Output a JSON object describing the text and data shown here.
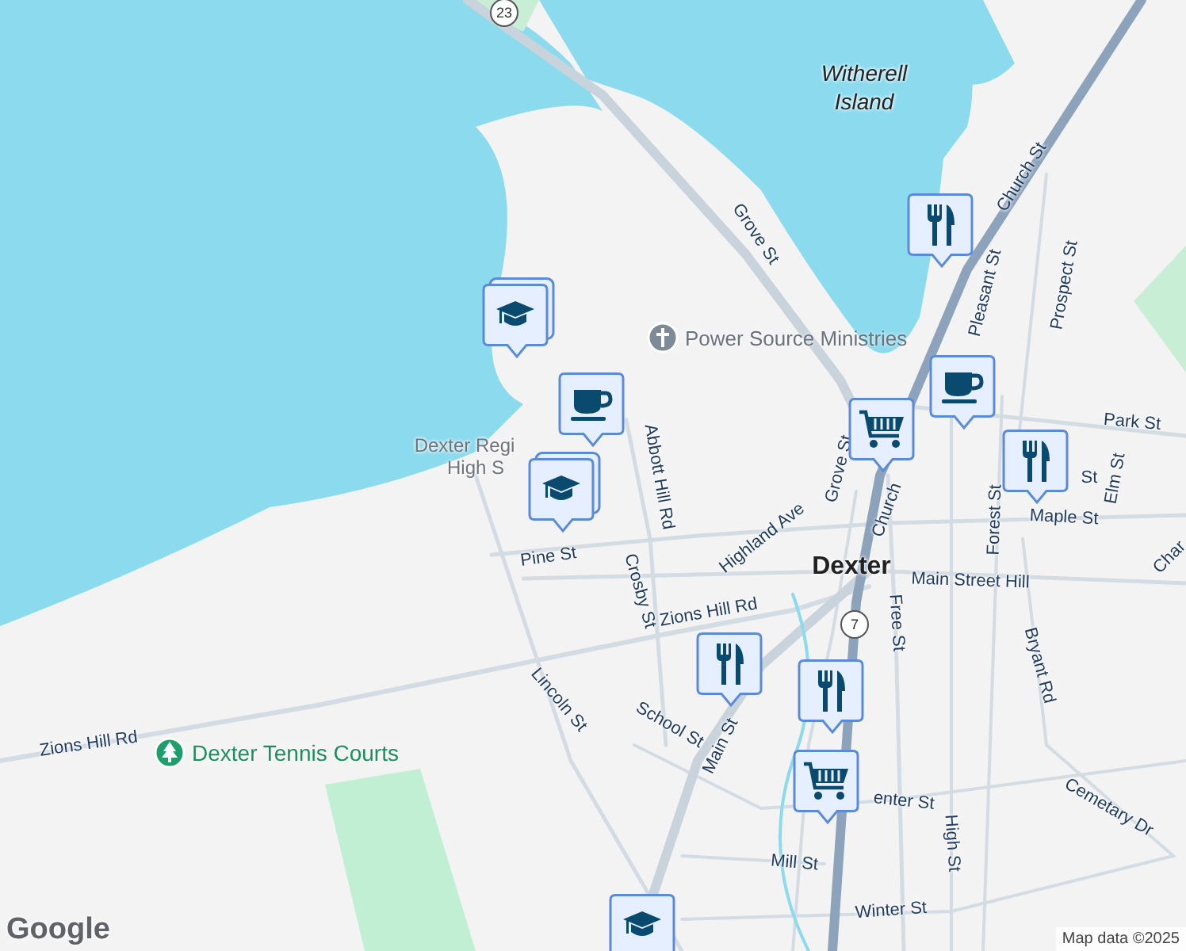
{
  "map": {
    "labels": [
      {
        "text": "Witherell",
        "kind": "island"
      },
      {
        "text": "Island",
        "kind": "island"
      },
      {
        "text": "Grove St",
        "kind": "street"
      },
      {
        "text": "Church St",
        "kind": "street"
      },
      {
        "text": "Pleasant St",
        "kind": "street"
      },
      {
        "text": "Prospect St",
        "kind": "street"
      },
      {
        "text": "Park St",
        "kind": "street"
      },
      {
        "text": "Dexter Regi",
        "kind": "poi"
      },
      {
        "text": "High S",
        "kind": "poi"
      },
      {
        "text": "Abbott Hill Rd",
        "kind": "street"
      },
      {
        "text": "Grove St",
        "kind": "street"
      },
      {
        "text": "Church",
        "kind": "street"
      },
      {
        "text": "Forest St",
        "kind": "street"
      },
      {
        "text": "St",
        "kind": "street"
      },
      {
        "text": "Elm St",
        "kind": "street"
      },
      {
        "text": "Maple St",
        "kind": "street"
      },
      {
        "text": "Highland Ave",
        "kind": "street"
      },
      {
        "text": "Pine St",
        "kind": "street"
      },
      {
        "text": "Crosby St",
        "kind": "street"
      },
      {
        "text": "Dexter",
        "kind": "town"
      },
      {
        "text": "Main Street Hill",
        "kind": "street"
      },
      {
        "text": "Char",
        "kind": "street"
      },
      {
        "text": "Zions Hill Rd",
        "kind": "street"
      },
      {
        "text": "Free St",
        "kind": "street"
      },
      {
        "text": "Bryant Rd",
        "kind": "street"
      },
      {
        "text": "Lincoln St",
        "kind": "street"
      },
      {
        "text": "School St",
        "kind": "street"
      },
      {
        "text": "Main St",
        "kind": "street"
      },
      {
        "text": "Zions Hill Rd",
        "kind": "street"
      },
      {
        "text": "enter St",
        "kind": "street"
      },
      {
        "text": "High St",
        "kind": "street"
      },
      {
        "text": "Cemetary Dr",
        "kind": "street"
      },
      {
        "text": "Mill St",
        "kind": "street"
      },
      {
        "text": "Winter St",
        "kind": "street"
      }
    ],
    "places": [
      {
        "name": "Power Source Ministries",
        "kind": "church"
      },
      {
        "name": "Dexter Tennis Courts",
        "kind": "park"
      }
    ],
    "shields": [
      "23",
      "7"
    ],
    "markers": [
      {
        "kind": "school",
        "stacked": true
      },
      {
        "kind": "cafe",
        "stacked": false
      },
      {
        "kind": "school",
        "stacked": true
      },
      {
        "kind": "restaurant",
        "stacked": false
      },
      {
        "kind": "cafe",
        "stacked": false
      },
      {
        "kind": "shopping",
        "stacked": false
      },
      {
        "kind": "restaurant",
        "stacked": false
      },
      {
        "kind": "restaurant",
        "stacked": false
      },
      {
        "kind": "restaurant",
        "stacked": false
      },
      {
        "kind": "shopping",
        "stacked": false
      },
      {
        "kind": "school",
        "stacked": false
      }
    ],
    "logo": "Google",
    "attribution": "Map data ©2025"
  }
}
